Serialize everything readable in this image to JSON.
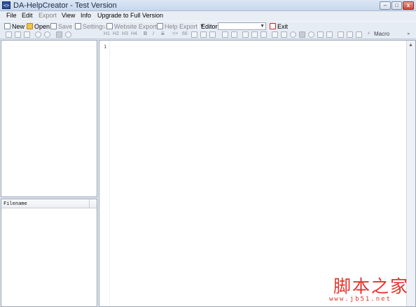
{
  "window": {
    "title": "DA-HelpCreator - Test Version",
    "icon_name": "app-icon",
    "icon_text": "<>",
    "buttons": {
      "minimize": "–",
      "maximize": "□",
      "close": "x"
    }
  },
  "menu": {
    "items": [
      {
        "label": "File",
        "enabled": true
      },
      {
        "label": "Edit",
        "enabled": true
      },
      {
        "label": "Export",
        "enabled": false
      },
      {
        "label": "View",
        "enabled": true
      },
      {
        "label": "Info",
        "enabled": true
      },
      {
        "label": "Upgrade to Full Version",
        "enabled": true
      }
    ]
  },
  "toolbar": {
    "new_label": "New",
    "open_label": "Open",
    "save_label": "Save",
    "settings_label": "Settings",
    "website_export_label": "Website Export",
    "help_export_label": "Help Export",
    "editor_label": "Editor",
    "editor_value": "",
    "exit_label": "Exit"
  },
  "format_toolbar": {
    "headings": [
      "H1",
      "H2",
      "H3",
      "H4"
    ],
    "bold": "B",
    "italic": "I",
    "strike": "S",
    "code": "<>",
    "quote": "66",
    "macro_label": "Macro"
  },
  "file_panel": {
    "column_header": "Filename"
  },
  "editor": {
    "line_numbers": [
      "1"
    ]
  },
  "watermark": {
    "chinese": "脚本之家",
    "url": "www.jb51.net"
  },
  "colors": {
    "accent": "#2a4f9a",
    "watermark": "#e2342a",
    "chrome": "#e6ecf4"
  }
}
